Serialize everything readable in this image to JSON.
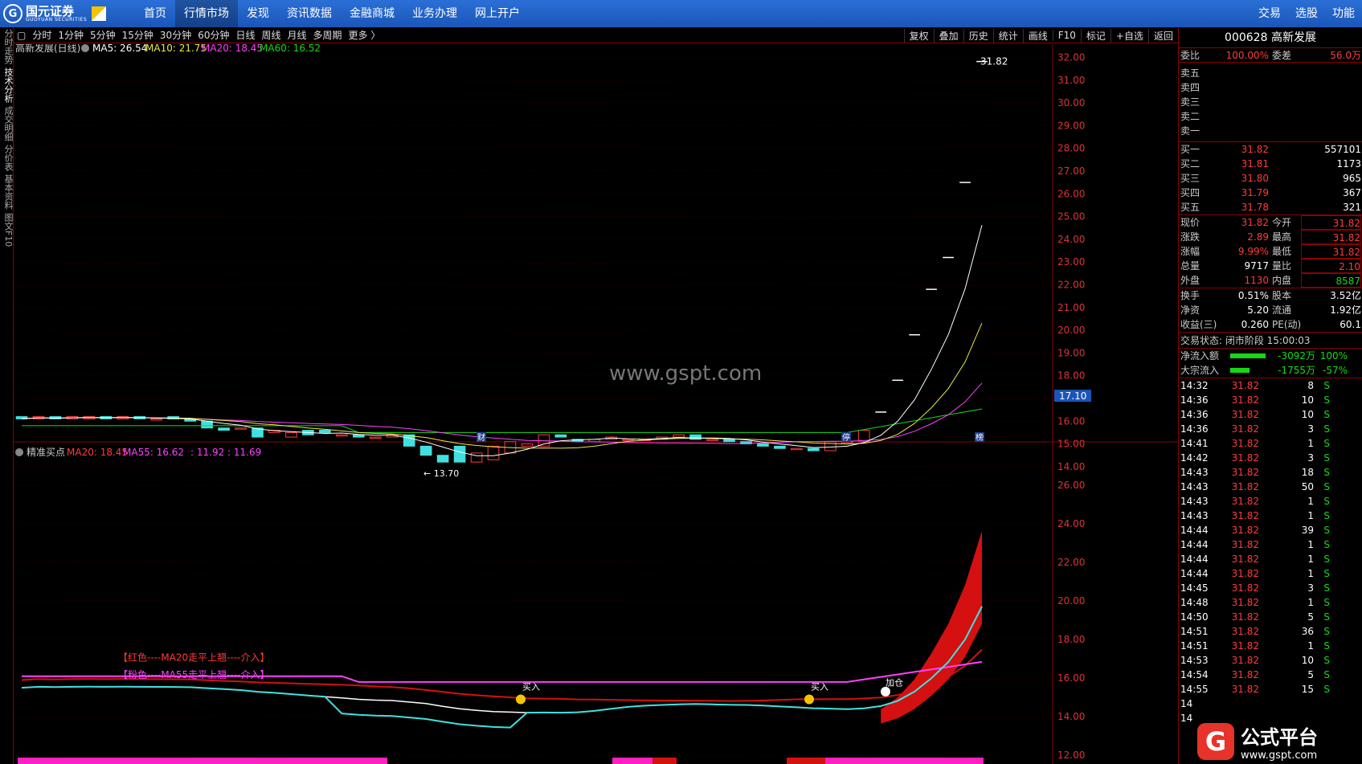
{
  "brand": {
    "name": "国元证券",
    "sub": "GUOYUAN SECURITIES"
  },
  "nav": [
    "首页",
    "行情市场",
    "发现",
    "资讯数据",
    "金融商城",
    "业务办理",
    "网上开户"
  ],
  "nav_active": "行情市场",
  "top_right": [
    "交易",
    "选股",
    "功能"
  ],
  "vtabs": [
    "分时走势",
    "技术分析",
    "成交明细",
    "分价表",
    "基本资料",
    "图文F10"
  ],
  "toolbar": {
    "left": [
      "分时",
      "1分钟",
      "5分钟",
      "15分钟",
      "30分钟",
      "60分钟",
      "日线",
      "周线",
      "月线",
      "多周期",
      "更多 〉"
    ],
    "right": [
      "复权",
      "叠加",
      "历史",
      "统计",
      "画线",
      "F10",
      "标记",
      "+自选",
      "返回"
    ]
  },
  "upper": {
    "name": "高新发展(日线)",
    "ma5": "MA5: 26.54",
    "ma10": "MA10: 21.75",
    "ma20": "MA20: 18.45",
    "ma60": "MA60: 16.52",
    "high_label": "31.82",
    "low_label": "← 13.70",
    "current_tag": "17.10",
    "marks": [
      "财",
      "停",
      "榜"
    ],
    "yticks": [
      "32.00",
      "31.00",
      "30.00",
      "29.00",
      "28.00",
      "27.00",
      "26.00",
      "25.00",
      "24.00",
      "23.00",
      "22.00",
      "21.00",
      "20.00",
      "19.00",
      "18.00",
      "17.00",
      "16.00",
      "15.00",
      "14.00"
    ]
  },
  "lower": {
    "name": "精准买点",
    "ma20": "MA20: 18.45",
    "ma55": "MA55: 16.62",
    "extra": ": 11.92 : 11.69",
    "note1": "【红色----MA20走平上翘----介入】",
    "note2": "【粉色----MA55走平上翘----介入】",
    "buy1": "买入",
    "buy2": "买入",
    "add": "加仓",
    "yticks": [
      "26.00",
      "24.00",
      "22.00",
      "20.00",
      "18.00",
      "16.00",
      "14.00",
      "12.00"
    ]
  },
  "watermark": "www.gspt.com",
  "quote": {
    "title": "000628 高新发展",
    "wb_label": "委比",
    "wb_val": "100.00%",
    "wc_label": "委差",
    "wc_val": "56.0万",
    "sells": [
      "卖五",
      "卖四",
      "卖三",
      "卖二",
      "卖一"
    ],
    "buys": [
      {
        "l": "买一",
        "p": "31.82",
        "v": "557101"
      },
      {
        "l": "买二",
        "p": "31.81",
        "v": "1173"
      },
      {
        "l": "买三",
        "p": "31.80",
        "v": "965"
      },
      {
        "l": "买四",
        "p": "31.79",
        "v": "367"
      },
      {
        "l": "买五",
        "p": "31.78",
        "v": "321"
      }
    ],
    "stats": [
      {
        "l1": "现价",
        "v1": "31.82",
        "l2": "今开",
        "v2": "31.82",
        "c1": "red",
        "c2": "red"
      },
      {
        "l1": "涨跌",
        "v1": "2.89",
        "l2": "最高",
        "v2": "31.82",
        "c1": "red",
        "c2": "red"
      },
      {
        "l1": "涨幅",
        "v1": "9.99%",
        "l2": "最低",
        "v2": "31.82",
        "c1": "red",
        "c2": "red"
      },
      {
        "l1": "总量",
        "v1": "9717",
        "l2": "量比",
        "v2": "2.10",
        "c1": "white",
        "c2": "red"
      },
      {
        "l1": "外盘",
        "v1": "1130",
        "l2": "内盘",
        "v2": "8587",
        "c1": "red",
        "c2": "green"
      }
    ],
    "stats2": [
      {
        "l1": "换手",
        "v1": "0.51%",
        "l2": "股本",
        "v2": "3.52亿"
      },
      {
        "l1": "净资",
        "v1": "5.20",
        "l2": "流通",
        "v2": "1.92亿"
      },
      {
        "l1": "收益(三)",
        "v1": "0.260",
        "l2": "PE(动)",
        "v2": "60.1"
      }
    ],
    "status": "交易状态: 闭市阶段 15:00:03",
    "flow": [
      {
        "l": "净流入额",
        "v": "-3092万",
        "p": "100%"
      },
      {
        "l": "大宗流入",
        "v": "-1755万",
        "p": "-57%"
      }
    ],
    "ticks": [
      [
        "14:32",
        "31.82",
        "8"
      ],
      [
        "14:36",
        "31.82",
        "10"
      ],
      [
        "14:36",
        "31.82",
        "10"
      ],
      [
        "14:36",
        "31.82",
        "3"
      ],
      [
        "14:41",
        "31.82",
        "1"
      ],
      [
        "14:42",
        "31.82",
        "3"
      ],
      [
        "14:43",
        "31.82",
        "18"
      ],
      [
        "14:43",
        "31.82",
        "50"
      ],
      [
        "14:43",
        "31.82",
        "1"
      ],
      [
        "14:43",
        "31.82",
        "1"
      ],
      [
        "14:44",
        "31.82",
        "39"
      ],
      [
        "14:44",
        "31.82",
        "1"
      ],
      [
        "14:44",
        "31.82",
        "1"
      ],
      [
        "14:44",
        "31.82",
        "1"
      ],
      [
        "14:45",
        "31.82",
        "3"
      ],
      [
        "14:48",
        "31.82",
        "1"
      ],
      [
        "14:50",
        "31.82",
        "5"
      ],
      [
        "14:51",
        "31.82",
        "36"
      ],
      [
        "14:51",
        "31.82",
        "1"
      ],
      [
        "14:53",
        "31.82",
        "10"
      ],
      [
        "14:54",
        "31.82",
        "5"
      ],
      [
        "14:55",
        "31.82",
        "15"
      ],
      [
        "14",
        "",
        ""
      ],
      [
        "14",
        "",
        ""
      ]
    ],
    "tick_side": "S"
  },
  "gspt": {
    "cn": "公式平台",
    "url": "www.gspt.com"
  },
  "colors": {
    "ma5": "#ffffff",
    "ma10": "#e8e84a",
    "ma20": "#ff40ff",
    "ma60": "#16d916",
    "up": "#ff3b3b",
    "down": "#40e0e0"
  },
  "chart_data": {
    "type": "line",
    "title": "高新发展(日线)",
    "candles": {
      "x": [
        0,
        1,
        2,
        3,
        4,
        5,
        6,
        7,
        8,
        9,
        10,
        11,
        12,
        13,
        14,
        15,
        16,
        17,
        18,
        19,
        20,
        21,
        22,
        23,
        24,
        25,
        26,
        27,
        28,
        29,
        30,
        31,
        32,
        33,
        34,
        35,
        36,
        37,
        38,
        39,
        40,
        41,
        42,
        43,
        44,
        45,
        46,
        47,
        48,
        49,
        50,
        51,
        52,
        53,
        54,
        55,
        56,
        57
      ],
      "open": [
        16.2,
        16.1,
        16.2,
        16.1,
        16.1,
        16.2,
        16.1,
        16.2,
        16.1,
        16.2,
        16.1,
        16.0,
        15.7,
        15.7,
        15.7,
        15.5,
        15.3,
        15.6,
        15.6,
        15.4,
        15.4,
        15.3,
        15.3,
        15.4,
        14.9,
        14.5,
        14.9,
        14.2,
        14.3,
        14.6,
        14.9,
        14.9,
        15.4,
        15.2,
        15.1,
        15.2,
        15.2,
        15.2,
        15.2,
        15.3,
        15.4,
        15.2,
        15.2,
        15.1,
        15.0,
        14.9,
        14.8,
        14.8,
        14.7,
        15.1,
        15.1,
        15.6,
        16.4,
        17.8,
        19.8,
        21.8,
        23.2,
        28.9
      ],
      "close": [
        16.1,
        16.2,
        16.1,
        16.2,
        16.2,
        16.1,
        16.2,
        16.1,
        16.1,
        16.1,
        16.0,
        15.7,
        15.6,
        15.7,
        15.3,
        15.6,
        15.5,
        15.4,
        15.5,
        15.4,
        15.3,
        15.3,
        15.4,
        14.9,
        14.5,
        14.2,
        14.2,
        14.6,
        14.9,
        15.1,
        15.0,
        15.4,
        15.3,
        15.1,
        15.2,
        15.3,
        15.2,
        15.2,
        15.3,
        15.4,
        15.2,
        15.2,
        15.1,
        15.0,
        14.9,
        14.8,
        14.8,
        14.7,
        15.1,
        15.1,
        15.6,
        16.4,
        17.8,
        19.8,
        21.8,
        23.2,
        26.5,
        31.82
      ]
    },
    "series": [
      {
        "name": "MA5",
        "last": 26.54
      },
      {
        "name": "MA10",
        "last": 21.75
      },
      {
        "name": "MA20",
        "last": 18.45
      },
      {
        "name": "MA60",
        "last": 16.52
      }
    ],
    "ylim": [
      13.5,
      32.3
    ],
    "lower": {
      "title": "精准买点",
      "ylim": [
        11.8,
        27.2
      ],
      "series": [
        {
          "name": "MA20",
          "last": 18.45
        },
        {
          "name": "MA55",
          "last": 16.62
        }
      ]
    }
  }
}
